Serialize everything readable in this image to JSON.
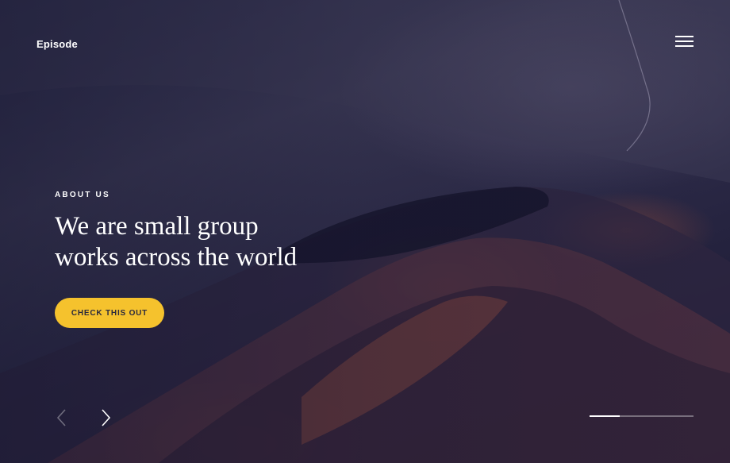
{
  "brand": {
    "name": "Episode"
  },
  "menu": {
    "icon": "hamburger-menu-icon"
  },
  "hero": {
    "eyebrow": "ABOUT US",
    "headline_lines": [
      "We are small group",
      "works across the world"
    ],
    "cta_label": "CHECK THIS OUT",
    "cta_color": "#f5c22d"
  },
  "slider": {
    "prev_icon": "chevron-left-icon",
    "next_icon": "chevron-right-icon",
    "progress": 0.29
  }
}
